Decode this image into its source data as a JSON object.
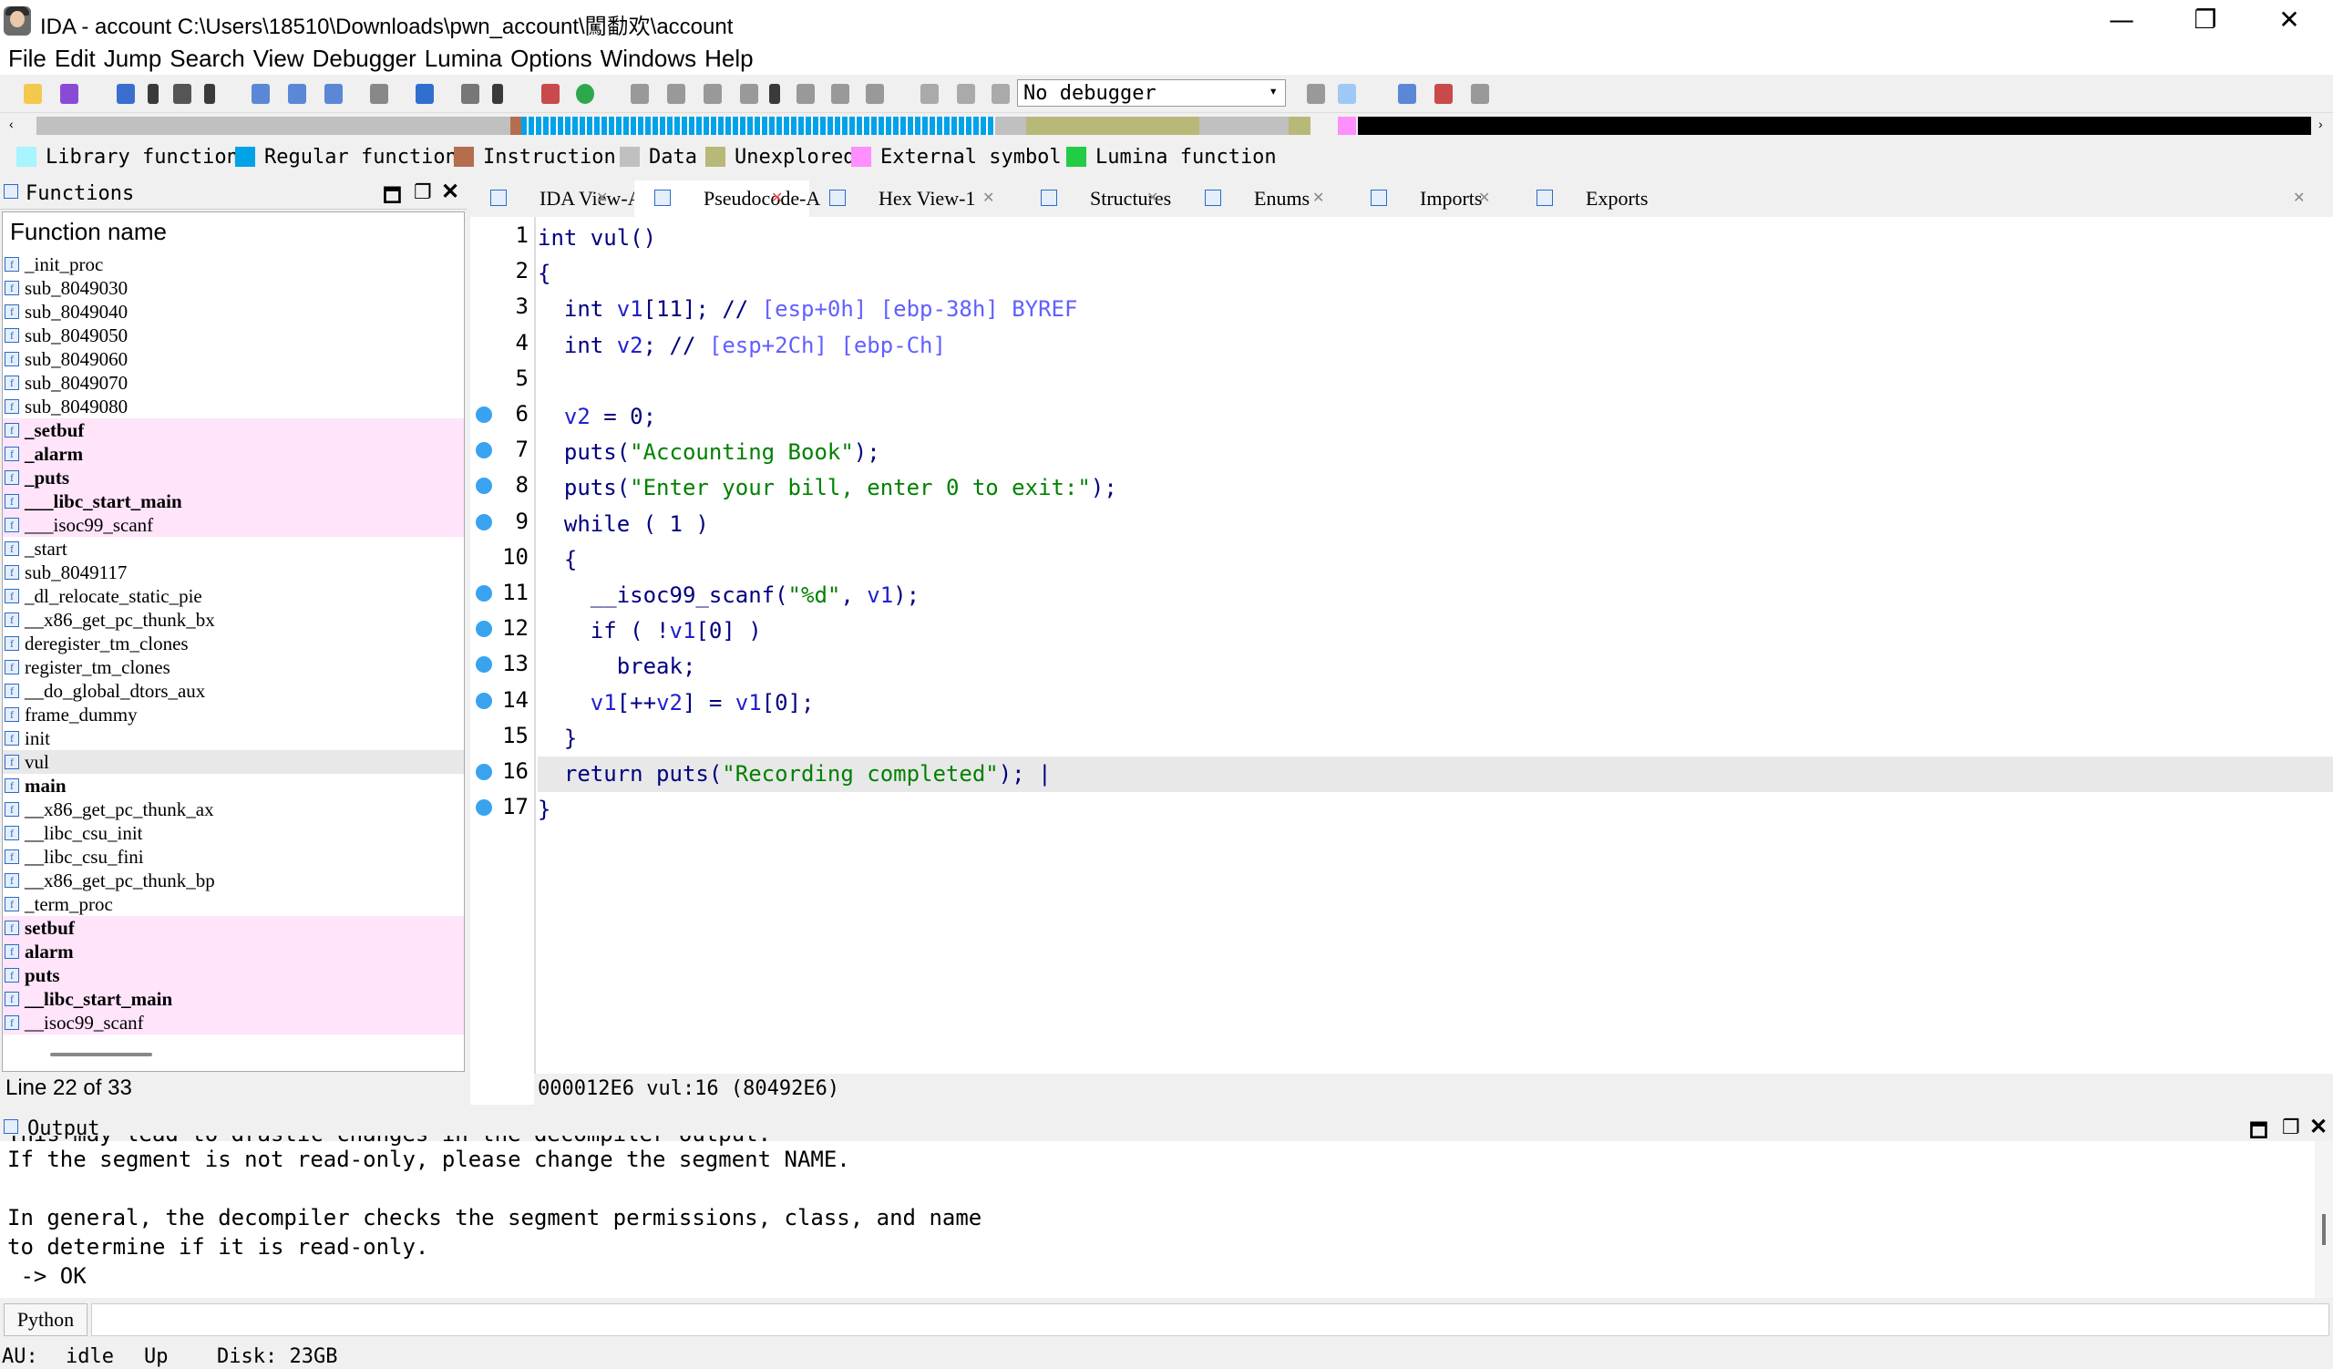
{
  "window": {
    "title": "IDA - account C:\\Users\\18510\\Downloads\\pwn_account\\闖勫欢\\account",
    "minimize": "—",
    "maximize": "❐",
    "close": "✕"
  },
  "menu": [
    "File",
    "Edit",
    "Jump",
    "Search",
    "View",
    "Debugger",
    "Lumina",
    "Options",
    "Windows",
    "Help"
  ],
  "toolbar": {
    "debugger_select": "No debugger"
  },
  "legend": [
    {
      "label": "Library function",
      "color": "#a8f4ff"
    },
    {
      "label": "Regular function",
      "color": "#00a2e8"
    },
    {
      "label": "Instruction",
      "color": "#b46e4d"
    },
    {
      "label": "Data",
      "color": "#c0c0c0"
    },
    {
      "label": "Unexplored",
      "color": "#b8b878"
    },
    {
      "label": "External symbol",
      "color": "#ff8eff"
    },
    {
      "label": "Lumina function",
      "color": "#22cc44"
    }
  ],
  "functions": {
    "title": "Functions",
    "column": "Function name",
    "status": "Line 22 of 33",
    "items": [
      {
        "name": "_init_proc",
        "style": "normal"
      },
      {
        "name": "sub_8049030",
        "style": "normal"
      },
      {
        "name": "sub_8049040",
        "style": "normal"
      },
      {
        "name": "sub_8049050",
        "style": "normal"
      },
      {
        "name": "sub_8049060",
        "style": "normal"
      },
      {
        "name": "sub_8049070",
        "style": "normal"
      },
      {
        "name": "sub_8049080",
        "style": "normal"
      },
      {
        "name": "_setbuf",
        "style": "libbold"
      },
      {
        "name": "_alarm",
        "style": "libbold"
      },
      {
        "name": "_puts",
        "style": "libbold"
      },
      {
        "name": "___libc_start_main",
        "style": "libbold"
      },
      {
        "name": "___isoc99_scanf",
        "style": "lib"
      },
      {
        "name": "_start",
        "style": "normal"
      },
      {
        "name": "sub_8049117",
        "style": "normal"
      },
      {
        "name": "_dl_relocate_static_pie",
        "style": "normal"
      },
      {
        "name": "__x86_get_pc_thunk_bx",
        "style": "normal"
      },
      {
        "name": "deregister_tm_clones",
        "style": "normal"
      },
      {
        "name": "register_tm_clones",
        "style": "normal"
      },
      {
        "name": "__do_global_dtors_aux",
        "style": "normal"
      },
      {
        "name": "frame_dummy",
        "style": "normal"
      },
      {
        "name": "init",
        "style": "normal"
      },
      {
        "name": "vul",
        "style": "selected"
      },
      {
        "name": "main",
        "style": "bold"
      },
      {
        "name": "__x86_get_pc_thunk_ax",
        "style": "normal"
      },
      {
        "name": "__libc_csu_init",
        "style": "normal"
      },
      {
        "name": "__libc_csu_fini",
        "style": "normal"
      },
      {
        "name": "__x86_get_pc_thunk_bp",
        "style": "normal"
      },
      {
        "name": "_term_proc",
        "style": "normal"
      },
      {
        "name": "setbuf",
        "style": "libbold"
      },
      {
        "name": "alarm",
        "style": "libbold"
      },
      {
        "name": "puts",
        "style": "libbold"
      },
      {
        "name": "__libc_start_main",
        "style": "libbold"
      },
      {
        "name": "__isoc99_scanf",
        "style": "lib"
      }
    ]
  },
  "tabs": [
    {
      "label": "IDA View-A"
    },
    {
      "label": "Pseudocode-A"
    },
    {
      "label": "Hex View-1"
    },
    {
      "label": "Structures"
    },
    {
      "label": "Enums"
    },
    {
      "label": "Imports"
    },
    {
      "label": "Exports"
    }
  ],
  "code": {
    "lines": [
      {
        "n": "1",
        "dot": false,
        "text": "int vul()"
      },
      {
        "n": "2",
        "dot": false,
        "text": "{"
      },
      {
        "n": "3",
        "dot": false,
        "text": "  int v1[11]; // [esp+0h] [ebp-38h] BYREF"
      },
      {
        "n": "4",
        "dot": false,
        "text": "  int v2; // [esp+2Ch] [ebp-Ch]"
      },
      {
        "n": "5",
        "dot": false,
        "text": ""
      },
      {
        "n": "6",
        "dot": true,
        "text": "  v2 = 0;"
      },
      {
        "n": "7",
        "dot": true,
        "text": "  puts(\"Accounting Book\");"
      },
      {
        "n": "8",
        "dot": true,
        "text": "  puts(\"Enter your bill, enter 0 to exit:\");"
      },
      {
        "n": "9",
        "dot": true,
        "text": "  while ( 1 )"
      },
      {
        "n": "10",
        "dot": false,
        "text": "  {"
      },
      {
        "n": "11",
        "dot": true,
        "text": "    __isoc99_scanf(\"%d\", v1);"
      },
      {
        "n": "12",
        "dot": true,
        "text": "    if ( !v1[0] )"
      },
      {
        "n": "13",
        "dot": true,
        "text": "      break;"
      },
      {
        "n": "14",
        "dot": true,
        "text": "    v1[++v2] = v1[0];"
      },
      {
        "n": "15",
        "dot": false,
        "text": "  }"
      },
      {
        "n": "16",
        "dot": true,
        "text": "  return puts(\"Recording completed\"); |"
      },
      {
        "n": "17",
        "dot": true,
        "text": "}"
      }
    ],
    "status": "000012E6 vul:16 (80492E6)"
  },
  "output": {
    "title": "Output",
    "partial_line": "This may lead to drastic changes in the decompiler output.",
    "lines": [
      "If the segment is not read-only, please change the segment NAME.",
      "",
      "In general, the decompiler checks the segment permissions, class, and name",
      "to determine if it is read-only.",
      " -> OK"
    ]
  },
  "python": {
    "label": "Python"
  },
  "status": {
    "au": "AU:",
    "state": "idle",
    "dir": "Up",
    "disk": "Disk: 23GB"
  }
}
